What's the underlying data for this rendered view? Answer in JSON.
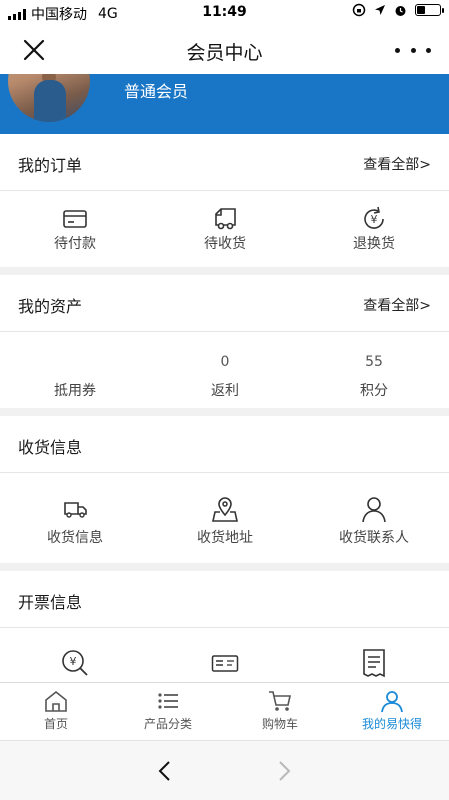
{
  "status": {
    "carrier": "中国移动",
    "network": "4G",
    "time": "11:49",
    "battery_level": 0.3
  },
  "nav": {
    "title": "会员中心"
  },
  "profile": {
    "member_level": "普通会员"
  },
  "orders": {
    "title": "我的订单",
    "view_all": "查看全部>",
    "items": [
      {
        "label": "待付款",
        "icon": "card-icon"
      },
      {
        "label": "待收货",
        "icon": "truck-icon"
      },
      {
        "label": "退换货",
        "icon": "yen-refresh-icon"
      }
    ]
  },
  "assets": {
    "title": "我的资产",
    "view_all": "查看全部>",
    "items": [
      {
        "label": "抵用券",
        "value": ""
      },
      {
        "label": "返利",
        "value": "0"
      },
      {
        "label": "积分",
        "value": "55"
      }
    ]
  },
  "shipping": {
    "title": "收货信息",
    "items": [
      {
        "label": "收货信息",
        "icon": "delivery-truck-icon"
      },
      {
        "label": "收货地址",
        "icon": "map-pin-icon"
      },
      {
        "label": "收货联系人",
        "icon": "person-icon"
      }
    ]
  },
  "invoice": {
    "title": "开票信息",
    "items": [
      {
        "icon": "yen-search-icon"
      },
      {
        "icon": "invoice-ticket-icon"
      },
      {
        "icon": "document-icon"
      }
    ]
  },
  "tabbar": {
    "items": [
      {
        "label": "首页",
        "icon": "home-icon"
      },
      {
        "label": "产品分类",
        "icon": "list-icon"
      },
      {
        "label": "购物车",
        "icon": "cart-icon"
      },
      {
        "label": "我的易快得",
        "icon": "user-icon",
        "active": true
      }
    ],
    "active_color": "#1a8ad6"
  },
  "colors": {
    "header_blue": "#1976c6"
  }
}
